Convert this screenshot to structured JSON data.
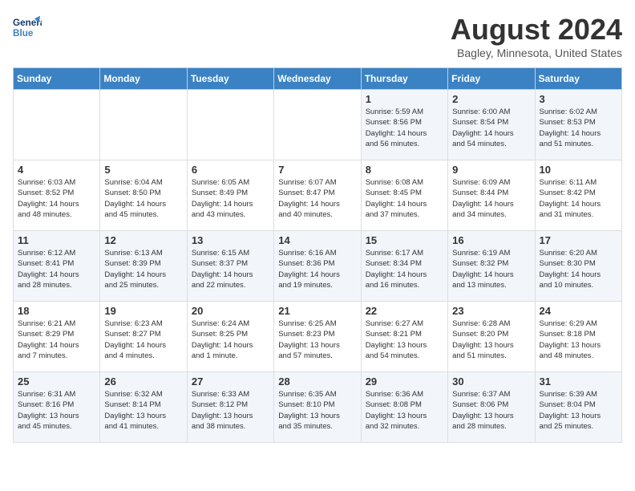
{
  "header": {
    "logo_line1": "General",
    "logo_line2": "Blue",
    "title": "August 2024",
    "location": "Bagley, Minnesota, United States"
  },
  "days_of_week": [
    "Sunday",
    "Monday",
    "Tuesday",
    "Wednesday",
    "Thursday",
    "Friday",
    "Saturday"
  ],
  "weeks": [
    [
      {
        "day": "",
        "info": ""
      },
      {
        "day": "",
        "info": ""
      },
      {
        "day": "",
        "info": ""
      },
      {
        "day": "",
        "info": ""
      },
      {
        "day": "1",
        "info": "Sunrise: 5:59 AM\nSunset: 8:56 PM\nDaylight: 14 hours\nand 56 minutes."
      },
      {
        "day": "2",
        "info": "Sunrise: 6:00 AM\nSunset: 8:54 PM\nDaylight: 14 hours\nand 54 minutes."
      },
      {
        "day": "3",
        "info": "Sunrise: 6:02 AM\nSunset: 8:53 PM\nDaylight: 14 hours\nand 51 minutes."
      }
    ],
    [
      {
        "day": "4",
        "info": "Sunrise: 6:03 AM\nSunset: 8:52 PM\nDaylight: 14 hours\nand 48 minutes."
      },
      {
        "day": "5",
        "info": "Sunrise: 6:04 AM\nSunset: 8:50 PM\nDaylight: 14 hours\nand 45 minutes."
      },
      {
        "day": "6",
        "info": "Sunrise: 6:05 AM\nSunset: 8:49 PM\nDaylight: 14 hours\nand 43 minutes."
      },
      {
        "day": "7",
        "info": "Sunrise: 6:07 AM\nSunset: 8:47 PM\nDaylight: 14 hours\nand 40 minutes."
      },
      {
        "day": "8",
        "info": "Sunrise: 6:08 AM\nSunset: 8:45 PM\nDaylight: 14 hours\nand 37 minutes."
      },
      {
        "day": "9",
        "info": "Sunrise: 6:09 AM\nSunset: 8:44 PM\nDaylight: 14 hours\nand 34 minutes."
      },
      {
        "day": "10",
        "info": "Sunrise: 6:11 AM\nSunset: 8:42 PM\nDaylight: 14 hours\nand 31 minutes."
      }
    ],
    [
      {
        "day": "11",
        "info": "Sunrise: 6:12 AM\nSunset: 8:41 PM\nDaylight: 14 hours\nand 28 minutes."
      },
      {
        "day": "12",
        "info": "Sunrise: 6:13 AM\nSunset: 8:39 PM\nDaylight: 14 hours\nand 25 minutes."
      },
      {
        "day": "13",
        "info": "Sunrise: 6:15 AM\nSunset: 8:37 PM\nDaylight: 14 hours\nand 22 minutes."
      },
      {
        "day": "14",
        "info": "Sunrise: 6:16 AM\nSunset: 8:36 PM\nDaylight: 14 hours\nand 19 minutes."
      },
      {
        "day": "15",
        "info": "Sunrise: 6:17 AM\nSunset: 8:34 PM\nDaylight: 14 hours\nand 16 minutes."
      },
      {
        "day": "16",
        "info": "Sunrise: 6:19 AM\nSunset: 8:32 PM\nDaylight: 14 hours\nand 13 minutes."
      },
      {
        "day": "17",
        "info": "Sunrise: 6:20 AM\nSunset: 8:30 PM\nDaylight: 14 hours\nand 10 minutes."
      }
    ],
    [
      {
        "day": "18",
        "info": "Sunrise: 6:21 AM\nSunset: 8:29 PM\nDaylight: 14 hours\nand 7 minutes."
      },
      {
        "day": "19",
        "info": "Sunrise: 6:23 AM\nSunset: 8:27 PM\nDaylight: 14 hours\nand 4 minutes."
      },
      {
        "day": "20",
        "info": "Sunrise: 6:24 AM\nSunset: 8:25 PM\nDaylight: 14 hours\nand 1 minute."
      },
      {
        "day": "21",
        "info": "Sunrise: 6:25 AM\nSunset: 8:23 PM\nDaylight: 13 hours\nand 57 minutes."
      },
      {
        "day": "22",
        "info": "Sunrise: 6:27 AM\nSunset: 8:21 PM\nDaylight: 13 hours\nand 54 minutes."
      },
      {
        "day": "23",
        "info": "Sunrise: 6:28 AM\nSunset: 8:20 PM\nDaylight: 13 hours\nand 51 minutes."
      },
      {
        "day": "24",
        "info": "Sunrise: 6:29 AM\nSunset: 8:18 PM\nDaylight: 13 hours\nand 48 minutes."
      }
    ],
    [
      {
        "day": "25",
        "info": "Sunrise: 6:31 AM\nSunset: 8:16 PM\nDaylight: 13 hours\nand 45 minutes."
      },
      {
        "day": "26",
        "info": "Sunrise: 6:32 AM\nSunset: 8:14 PM\nDaylight: 13 hours\nand 41 minutes."
      },
      {
        "day": "27",
        "info": "Sunrise: 6:33 AM\nSunset: 8:12 PM\nDaylight: 13 hours\nand 38 minutes."
      },
      {
        "day": "28",
        "info": "Sunrise: 6:35 AM\nSunset: 8:10 PM\nDaylight: 13 hours\nand 35 minutes."
      },
      {
        "day": "29",
        "info": "Sunrise: 6:36 AM\nSunset: 8:08 PM\nDaylight: 13 hours\nand 32 minutes."
      },
      {
        "day": "30",
        "info": "Sunrise: 6:37 AM\nSunset: 8:06 PM\nDaylight: 13 hours\nand 28 minutes."
      },
      {
        "day": "31",
        "info": "Sunrise: 6:39 AM\nSunset: 8:04 PM\nDaylight: 13 hours\nand 25 minutes."
      }
    ]
  ]
}
